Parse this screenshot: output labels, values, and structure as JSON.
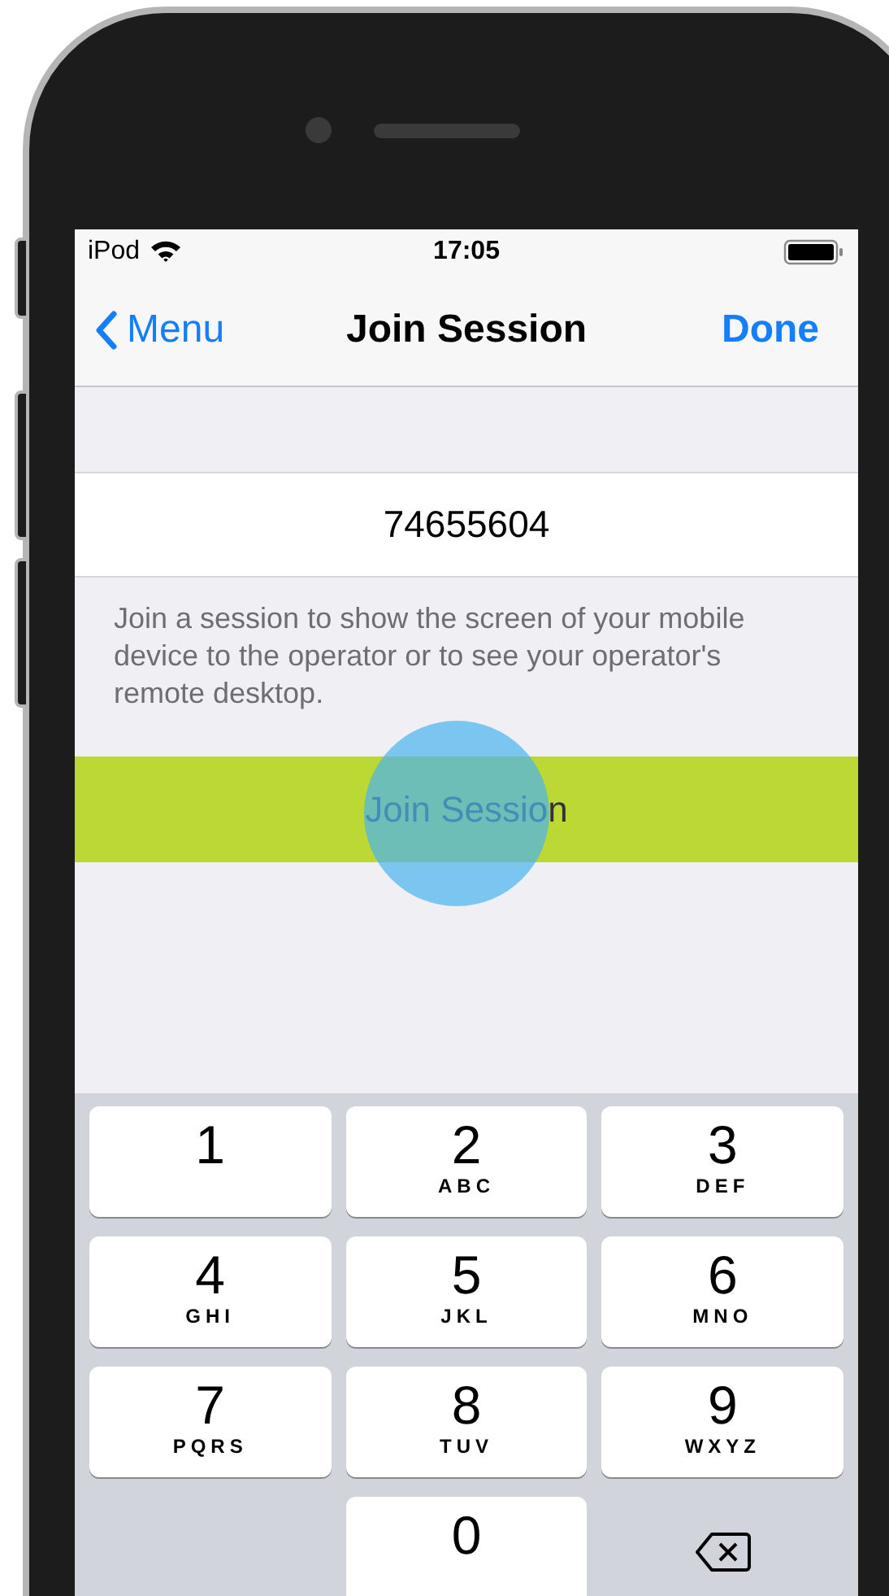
{
  "status_bar": {
    "carrier": "iPod",
    "time": "17:05"
  },
  "nav_bar": {
    "back": "Menu",
    "title": "Join Session",
    "action": "Done"
  },
  "session_field": {
    "value": "74655604"
  },
  "description": "Join a session to show the screen of your mobile device to the operator or to see your operator's remote desktop.",
  "join_button": {
    "label": "Join Session"
  },
  "keypad": [
    {
      "kind": "digit",
      "digit": "1"
    },
    {
      "kind": "digit",
      "digit": "2",
      "letters": "ABC"
    },
    {
      "kind": "digit",
      "digit": "3",
      "letters": "DEF"
    },
    {
      "kind": "digit",
      "digit": "4",
      "letters": "GHI"
    },
    {
      "kind": "digit",
      "digit": "5",
      "letters": "JKL"
    },
    {
      "kind": "digit",
      "digit": "6",
      "letters": "MNO"
    },
    {
      "kind": "digit",
      "digit": "7",
      "letters": "PQRS"
    },
    {
      "kind": "digit",
      "digit": "8",
      "letters": "TUV"
    },
    {
      "kind": "digit",
      "digit": "9",
      "letters": "WXYZ"
    },
    {
      "kind": "blank"
    },
    {
      "kind": "digit",
      "digit": "0"
    },
    {
      "kind": "delete"
    }
  ]
}
